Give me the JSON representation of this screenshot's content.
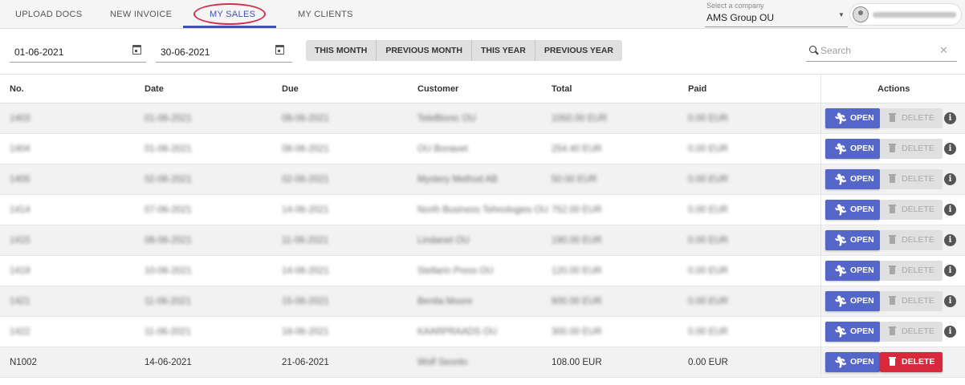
{
  "nav": {
    "tabs": [
      {
        "label": "UPLOAD DOCS"
      },
      {
        "label": "NEW INVOICE"
      },
      {
        "label": "MY SALES"
      },
      {
        "label": "MY CLIENTS"
      }
    ],
    "company_label": "Select a company",
    "company_value": "AMS Group OU",
    "accent_color": "#3f51b5"
  },
  "filters": {
    "date_from": "01-06-2021",
    "date_to": "30-06-2021",
    "ranges": [
      "THIS MONTH",
      "PREVIOUS MONTH",
      "THIS YEAR",
      "PREVIOUS YEAR"
    ],
    "search_placeholder": "Search",
    "search_value": ""
  },
  "table": {
    "headers": [
      "No.",
      "Date",
      "Due",
      "Customer",
      "Total",
      "Paid",
      "Actions"
    ],
    "open_label": "OPEN",
    "delete_label": "DELETE",
    "info_glyph": "i",
    "open_icon": "🏃︎",
    "rows": [
      {
        "no": "1403",
        "date": "01-06-2021",
        "due": "08-06-2021",
        "customer": "TeleBlonic OÜ",
        "total": "1050.00 EUR",
        "paid": "0.00 EUR",
        "blurred": true,
        "delete_enabled": false,
        "show_info": true
      },
      {
        "no": "1404",
        "date": "01-06-2021",
        "due": "08-06-2021",
        "customer": "OÜ Bonavet",
        "total": "254.40 EUR",
        "paid": "0.00 EUR",
        "blurred": true,
        "delete_enabled": false,
        "show_info": true
      },
      {
        "no": "1405",
        "date": "02-06-2021",
        "due": "02-06-2021",
        "customer": "Mystery Method AB",
        "total": "50.00 EUR",
        "paid": "0.00 EUR",
        "blurred": true,
        "delete_enabled": false,
        "show_info": true
      },
      {
        "no": "1414",
        "date": "07-06-2021",
        "due": "14-06-2021",
        "customer": "North Business Tehnologies OÜ",
        "total": "752.00 EUR",
        "paid": "0.00 EUR",
        "blurred": true,
        "delete_enabled": false,
        "show_info": true
      },
      {
        "no": "1415",
        "date": "08-06-2021",
        "due": "11-06-2021",
        "customer": "Lindanet OÜ",
        "total": "190.00 EUR",
        "paid": "0.00 EUR",
        "blurred": true,
        "delete_enabled": false,
        "show_info": true
      },
      {
        "no": "1419",
        "date": "10-06-2021",
        "due": "14-06-2021",
        "customer": "Stellarin Press OÜ",
        "total": "120.00 EUR",
        "paid": "0.00 EUR",
        "blurred": true,
        "delete_enabled": false,
        "show_info": true
      },
      {
        "no": "1421",
        "date": "11-06-2021",
        "due": "15-06-2021",
        "customer": "Benita Moore",
        "total": "600.00 EUR",
        "paid": "0.00 EUR",
        "blurred": true,
        "delete_enabled": false,
        "show_info": true
      },
      {
        "no": "1422",
        "date": "11-06-2021",
        "due": "18-06-2021",
        "customer": "KAARPRAADS OÜ",
        "total": "300.00 EUR",
        "paid": "0.00 EUR",
        "blurred": true,
        "delete_enabled": false,
        "show_info": true
      },
      {
        "no": "N1002",
        "date": "14-06-2021",
        "due": "21-06-2021",
        "customer": "Wolf Seonto",
        "total": "108.00 EUR",
        "paid": "0.00 EUR",
        "blurred": false,
        "customer_blurred": true,
        "delete_enabled": true,
        "show_info": false
      }
    ]
  }
}
